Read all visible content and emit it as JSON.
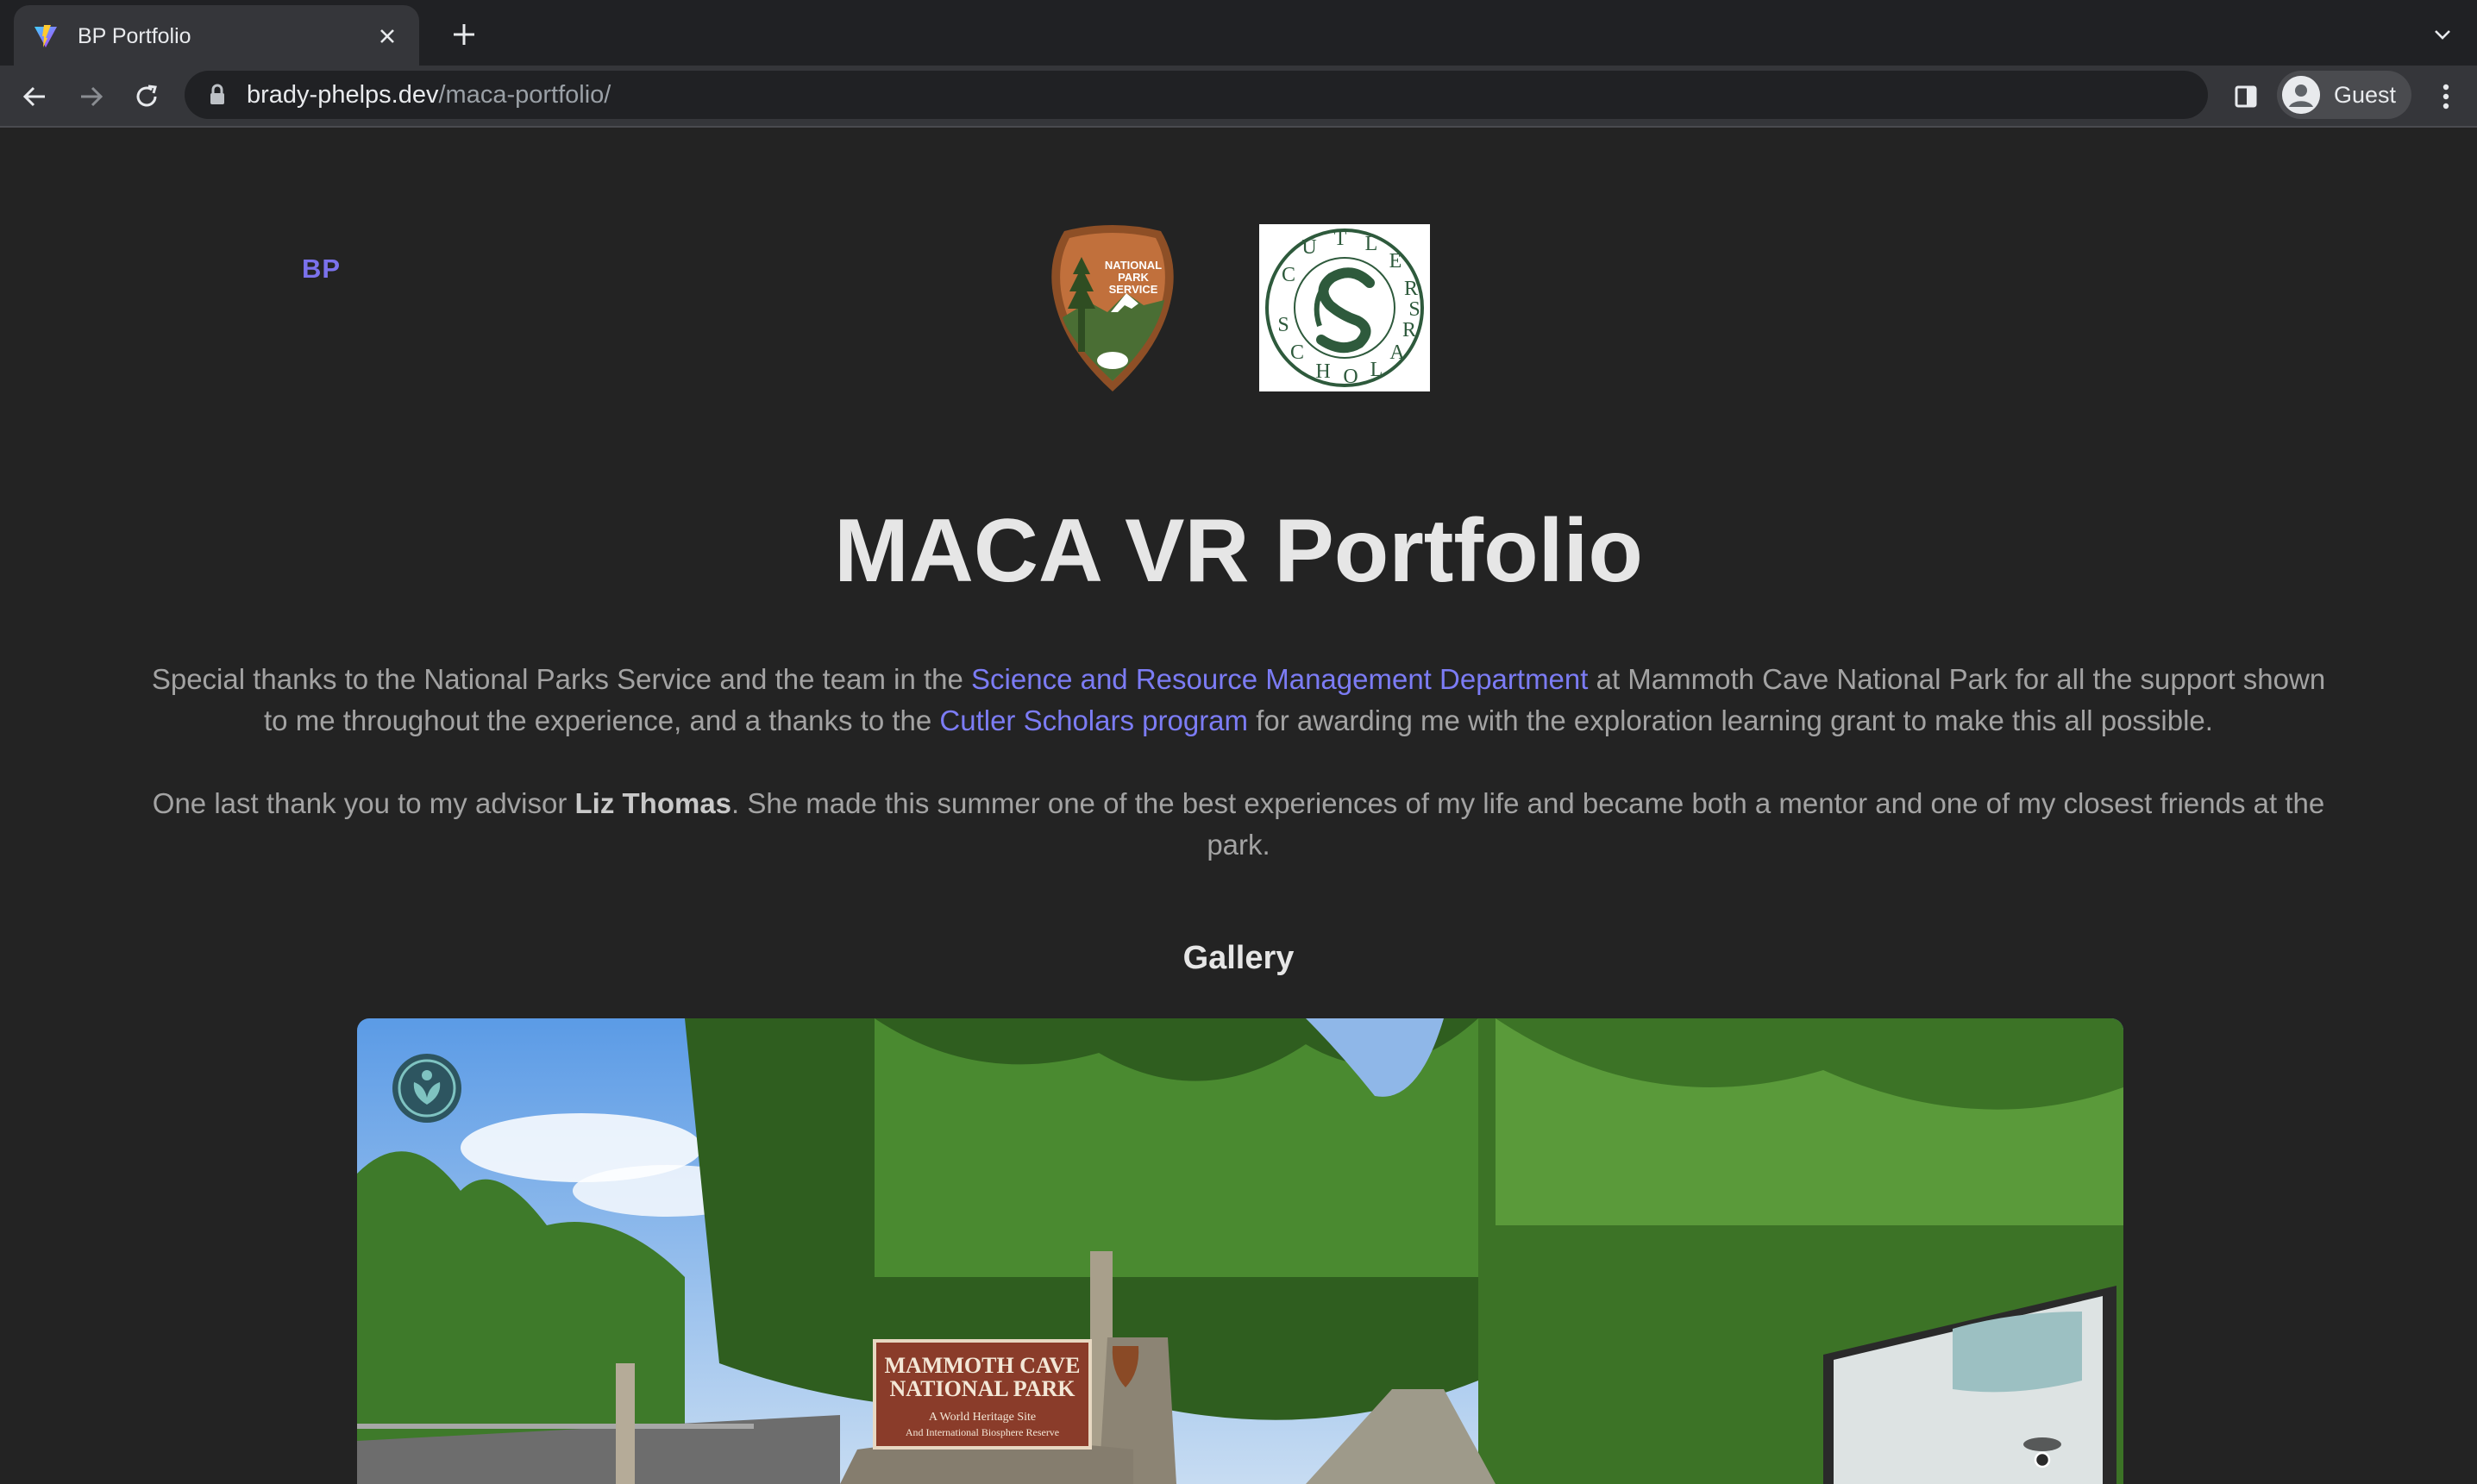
{
  "browser": {
    "tab_title": "BP Portfolio",
    "url_host": "brady-phelps.dev",
    "url_path": "/maca-portfolio/",
    "profile_label": "Guest"
  },
  "icons": [
    "vite-favicon",
    "close-icon",
    "plus-icon",
    "chevron-down-icon",
    "back-arrow-icon",
    "forward-arrow-icon",
    "reload-icon",
    "lock-icon",
    "side-panel-icon",
    "profile-icon",
    "kebab-menu-icon"
  ],
  "site": {
    "brand": "BP"
  },
  "logos": {
    "nps": "NATIONAL PARK SERVICE",
    "nps_lines": [
      "NATIONAL",
      "PARK",
      "SERVICE"
    ],
    "cutler": "CUTLER SCHOLARS"
  },
  "main": {
    "title": "MACA VR Portfolio",
    "p1_a": "Special thanks to the National Parks Service and the team in the ",
    "p1_link1": "Science and Resource Management Department",
    "p1_b": " at Mammoth Cave National Park for all the support shown to me throughout the experience, and a thanks to the ",
    "p1_link2": "Cutler Scholars program",
    "p1_c": " for awarding me with the exploration learning grant to make this all possible.",
    "p2_a": "One last thank you to my advisor ",
    "p2_strong": "Liz Thomas",
    "p2_b": ". She made this summer one of the best experiences of my life and became both a mentor and one of my closest friends at the park.",
    "gallery_heading": "Gallery"
  },
  "gallery": {
    "sign_line1": "MAMMOTH CAVE",
    "sign_line2": "NATIONAL PARK",
    "sign_line3": "A World Heritage Site",
    "sign_line4": "And International Biosphere Reserve"
  },
  "colors": {
    "page_bg": "#232323",
    "link": "#7c7cf5",
    "brand": "#7b72ec",
    "text": "#a3a3a3",
    "heading": "#e6e6e6"
  }
}
